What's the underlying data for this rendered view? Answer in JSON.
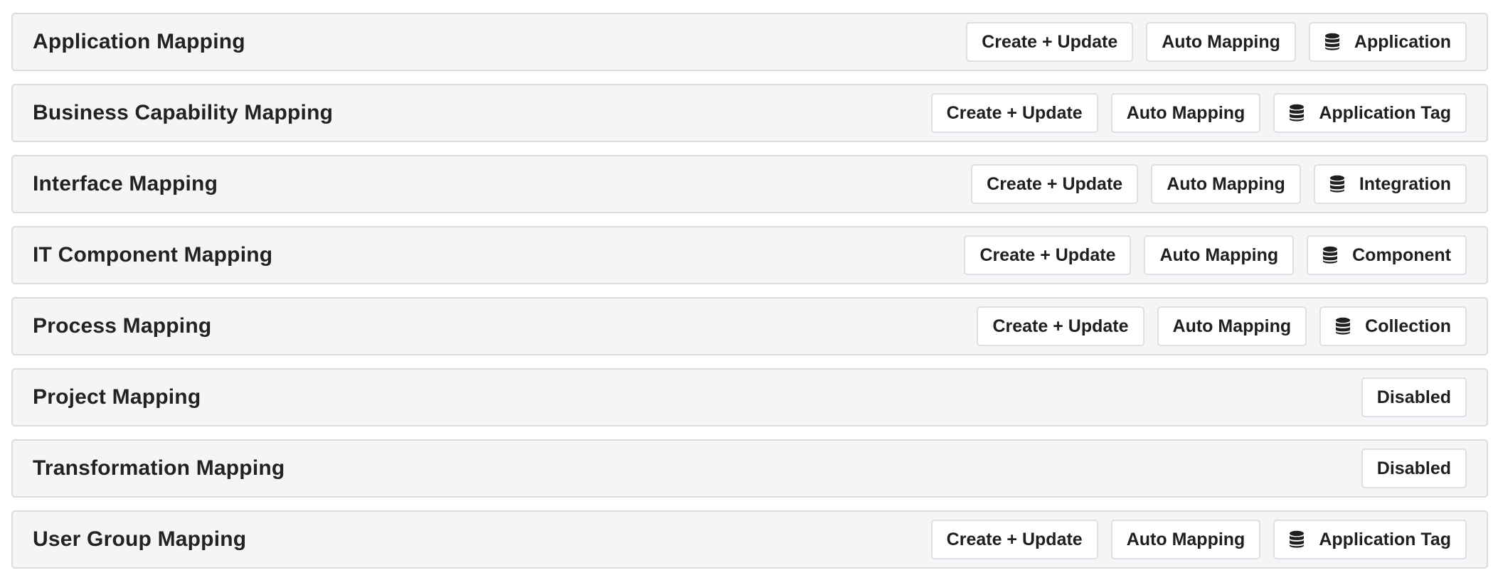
{
  "colors": {
    "row_background": "#f4f5f6",
    "row_border": "#d9dcdf",
    "button_background": "#ffffff",
    "button_border": "#dcdfe3",
    "text": "#1f1f1f"
  },
  "rows": [
    {
      "title": "Application Mapping",
      "buttons": [
        {
          "label": "Create + Update"
        },
        {
          "label": "Auto Mapping"
        },
        {
          "label": "Application",
          "icon": "database-icon"
        }
      ]
    },
    {
      "title": "Business Capability Mapping",
      "buttons": [
        {
          "label": "Create + Update"
        },
        {
          "label": "Auto Mapping"
        },
        {
          "label": "Application Tag",
          "icon": "database-icon"
        }
      ]
    },
    {
      "title": "Interface Mapping",
      "buttons": [
        {
          "label": "Create + Update"
        },
        {
          "label": "Auto Mapping"
        },
        {
          "label": "Integration",
          "icon": "database-icon"
        }
      ]
    },
    {
      "title": "IT Component Mapping",
      "buttons": [
        {
          "label": "Create + Update"
        },
        {
          "label": "Auto Mapping"
        },
        {
          "label": "Component",
          "icon": "database-icon"
        }
      ]
    },
    {
      "title": "Process Mapping",
      "buttons": [
        {
          "label": "Create + Update"
        },
        {
          "label": "Auto Mapping"
        },
        {
          "label": "Collection",
          "icon": "database-icon"
        }
      ]
    },
    {
      "title": "Project Mapping",
      "buttons": [
        {
          "label": "Disabled"
        }
      ]
    },
    {
      "title": "Transformation Mapping",
      "buttons": [
        {
          "label": "Disabled"
        }
      ]
    },
    {
      "title": "User Group Mapping",
      "buttons": [
        {
          "label": "Create + Update"
        },
        {
          "label": "Auto Mapping"
        },
        {
          "label": "Application Tag",
          "icon": "database-icon"
        }
      ]
    }
  ]
}
